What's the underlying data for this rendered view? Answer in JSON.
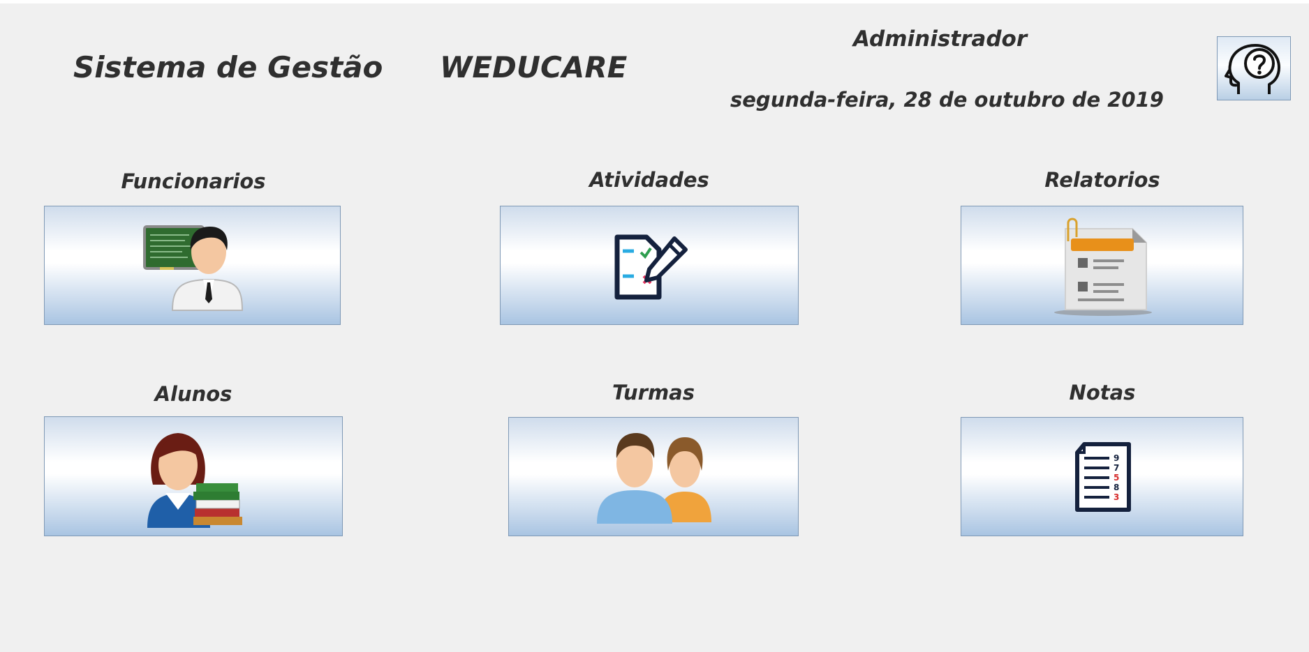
{
  "header": {
    "app_title": "Sistema de Gestão",
    "brand": "WEDUCARE",
    "user_role": "Administrador",
    "date": "segunda-feira, 28 de outubro de 2019"
  },
  "tiles": [
    {
      "label": "Funcionarios",
      "icon": "teacher-icon"
    },
    {
      "label": "Atividades",
      "icon": "edit-document-icon"
    },
    {
      "label": "Relatorios",
      "icon": "report-icon"
    },
    {
      "label": "Alunos",
      "icon": "student-icon"
    },
    {
      "label": "Turmas",
      "icon": "people-group-icon"
    },
    {
      "label": "Notas",
      "icon": "grades-document-icon"
    }
  ],
  "colors": {
    "background": "#f0f0f0",
    "tile_border": "#7e98b5",
    "tile_gradient_bottom": "#a9c4e2",
    "text": "#2f2f2f"
  }
}
